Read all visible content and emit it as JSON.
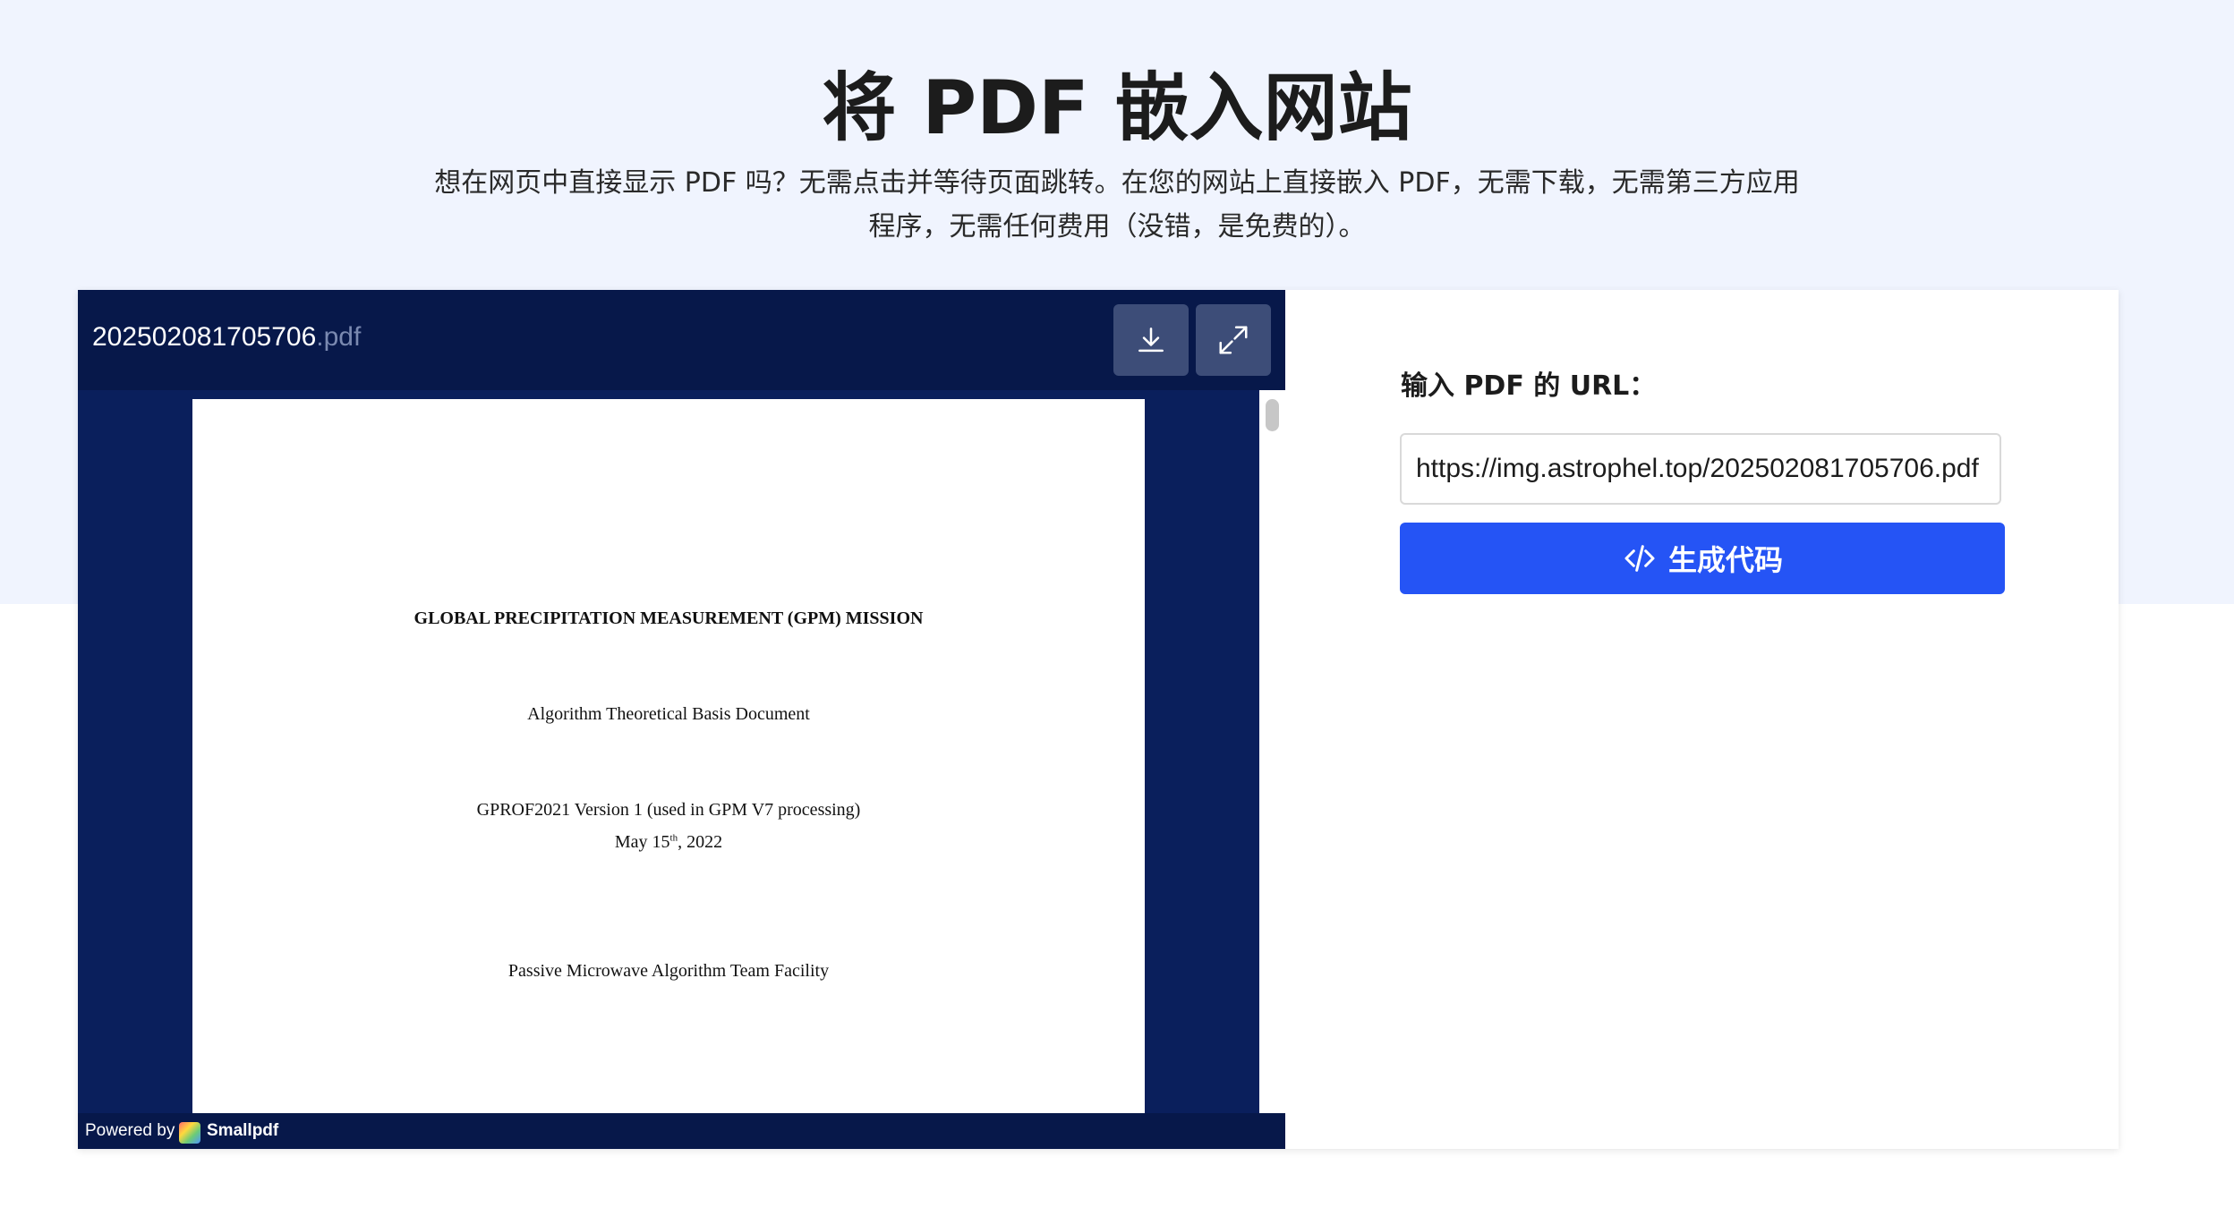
{
  "header": {
    "title": "将 PDF 嵌入网站",
    "subtitle_line1": "想在网页中直接显示 PDF 吗？无需点击并等待页面跳转。在您的网站上直接嵌入 PDF，无需下载，无需第三方应用",
    "subtitle_line2": "程序，无需任何费用（没错，是免费的）。"
  },
  "viewer": {
    "file_name": "202502081705706",
    "file_ext": ".pdf",
    "download_icon": "download-icon",
    "fullscreen_icon": "expand-icon",
    "page": {
      "line1": "GLOBAL PRECIPITATION MEASUREMENT (GPM) MISSION",
      "line2": "Algorithm Theoretical Basis Document",
      "line3": "GPROF2021 Version 1 (used in GPM V7 processing)",
      "line4_prefix": "May 15",
      "line4_sup": "th",
      "line4_suffix": ", 2022",
      "line5": "Passive Microwave Algorithm Team Facility"
    },
    "powered_by": "Powered by",
    "brand": "Smallpdf"
  },
  "form": {
    "label": "输入 PDF 的 URL：",
    "url_value": "https://img.astrophel.top/202502081705706.pdf",
    "button_label": "生成代码",
    "button_icon": "code-icon",
    "accent_color": "#2554f5"
  }
}
